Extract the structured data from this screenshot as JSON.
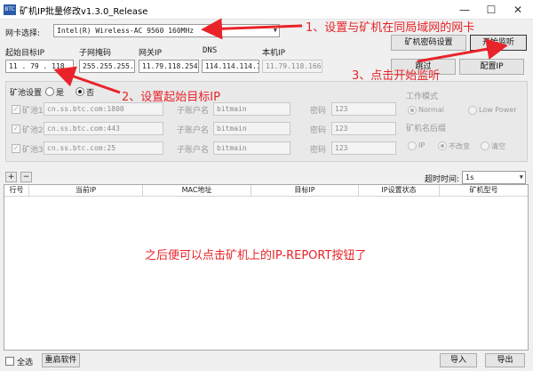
{
  "window": {
    "icon_text": "BTC",
    "title": "矿机IP批量修改v1.3.0_Release",
    "minimize": "—",
    "maximize": "☐",
    "close": "✕"
  },
  "network": {
    "label": "网卡选择:",
    "selected": "Intel(R) Wireless-AC 9560 160MHz"
  },
  "ip_fields": {
    "start_ip_label": "起始目标IP",
    "start_ip_value": "11 . 79 . 118 .",
    "subnet_label": "子网掩码",
    "subnet_value": "255.255.255.0",
    "gateway_label": "网关IP",
    "gateway_value": "11.79.118.254",
    "dns_label": "DNS",
    "dns_value": "114.114.114.114",
    "local_ip_label": "本机IP",
    "local_ip_value": "11.79.118.166"
  },
  "buttons": {
    "password_settings": "矿机密码设置",
    "start_listen": "开始监听",
    "skip": "跳过",
    "config_ip": "配置IP",
    "add": "+",
    "remove": "−",
    "select_all": "全选",
    "restart_software": "重启软件",
    "import": "导入",
    "export": "导出"
  },
  "pool_settings": {
    "label": "矿池设置",
    "yes": "是",
    "no": "否",
    "selected": "否",
    "pools": [
      {
        "label": "矿池1:",
        "url": "cn.ss.btc.com:1800",
        "user_label": "子账户名",
        "user": "bitmain",
        "pwd_label": "密码",
        "pwd": "123"
      },
      {
        "label": "矿池2:",
        "url": "cn.ss.btc.com:443",
        "user_label": "子账户名",
        "user": "bitmain",
        "pwd_label": "密码",
        "pwd": "123"
      },
      {
        "label": "矿池3:",
        "url": "cn.ss.btc.com:25",
        "user_label": "子账户名",
        "user": "bitmain",
        "pwd_label": "密码",
        "pwd": "123"
      }
    ]
  },
  "work_mode": {
    "label": "工作模式",
    "normal": "Normal",
    "low_power": "Low Power",
    "selected": "Normal"
  },
  "miner_name_rule": {
    "label": "矿机名后缀",
    "ip": "IP",
    "unchanged": "不改变",
    "clear": "清空",
    "selected": "不改变"
  },
  "timeout": {
    "label": "超时时间:",
    "value": "1s"
  },
  "table": {
    "columns": [
      "行号",
      "当前IP",
      "MAC地址",
      "目标IP",
      "IP设置状态",
      "矿机型号"
    ]
  },
  "annotations": {
    "step1": "1、设置与矿机在同局域网的网卡",
    "step2": "2、设置起始目标IP",
    "step3": "3、点击开始监听",
    "note": "之后便可以点击矿机上的IP-REPORT按钮了",
    "color": "#e8242a"
  }
}
